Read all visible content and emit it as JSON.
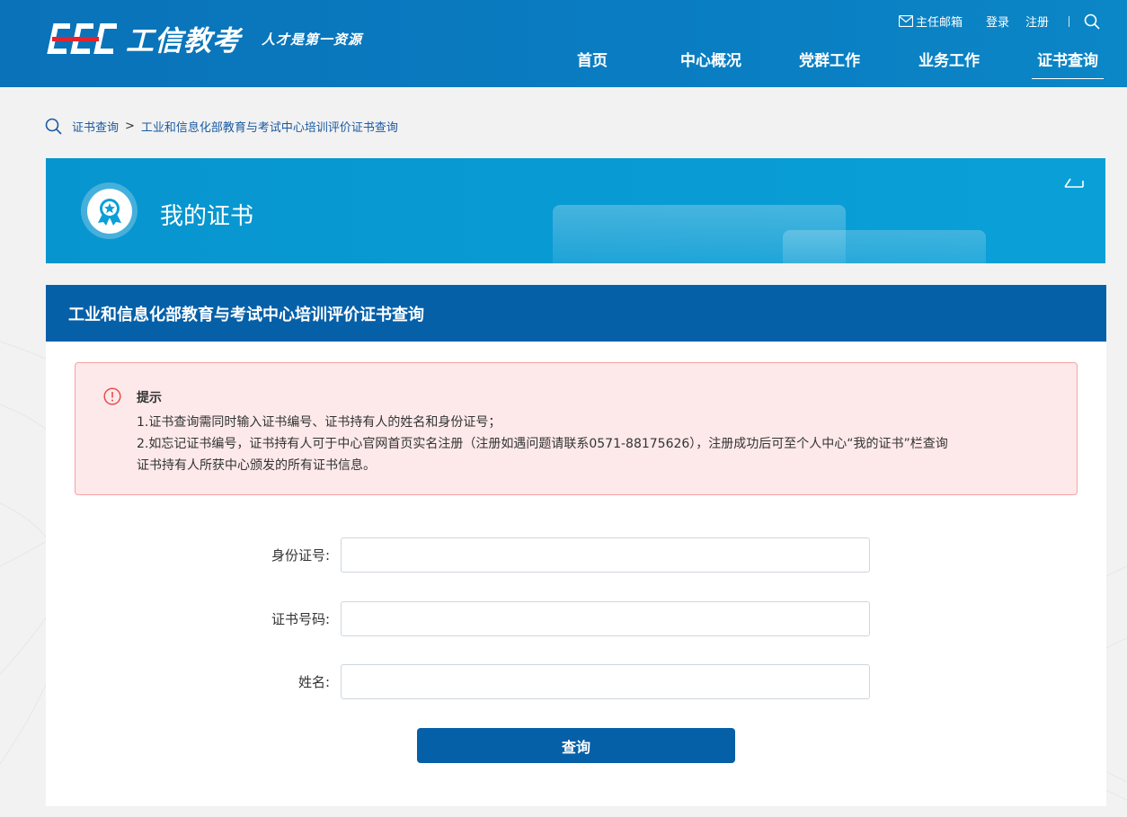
{
  "header": {
    "logo_text": "工信教考",
    "slogan": "人才是第一资源",
    "top_links": {
      "mailbox": "主任邮箱",
      "login": "登录",
      "register": "注册"
    },
    "nav": [
      {
        "label": "首页"
      },
      {
        "label": "中心概况"
      },
      {
        "label": "党群工作"
      },
      {
        "label": "业务工作"
      },
      {
        "label": "证书查询",
        "active": true
      }
    ]
  },
  "breadcrumb": {
    "items": [
      "证书查询",
      "工业和信息化部教育与考试中心培训评价证书查询"
    ],
    "separator": ">"
  },
  "banner": {
    "title": "我的证书"
  },
  "panel": {
    "title": "工业和信息化部教育与考试中心培训评价证书查询",
    "notice": {
      "title": "提示",
      "lines": [
        "1.证书查询需同时输入证书编号、证书持有人的姓名和身份证号；",
        "2.如忘记证书编号，证书持有人可于中心官网首页实名注册（注册如遇问题请联系0571-88175626），注册成功后可至个人中心“我的证书”栏查询",
        "证书持有人所获中心颁发的所有证书信息。"
      ]
    },
    "form": {
      "id_label": "身份证号:",
      "id_value": "",
      "cert_label": "证书号码:",
      "cert_value": "",
      "name_label": "姓名:",
      "name_value": "",
      "submit_label": "查询"
    }
  },
  "colors": {
    "header_blue": "#0a7dc2",
    "panel_header": "#0560a8",
    "banner_blue": "#0aa0d7",
    "notice_bg": "#fde9ea",
    "notice_border": "#f5a3a3",
    "warn_red": "#e84c4c",
    "logo_red": "#e5222d"
  }
}
